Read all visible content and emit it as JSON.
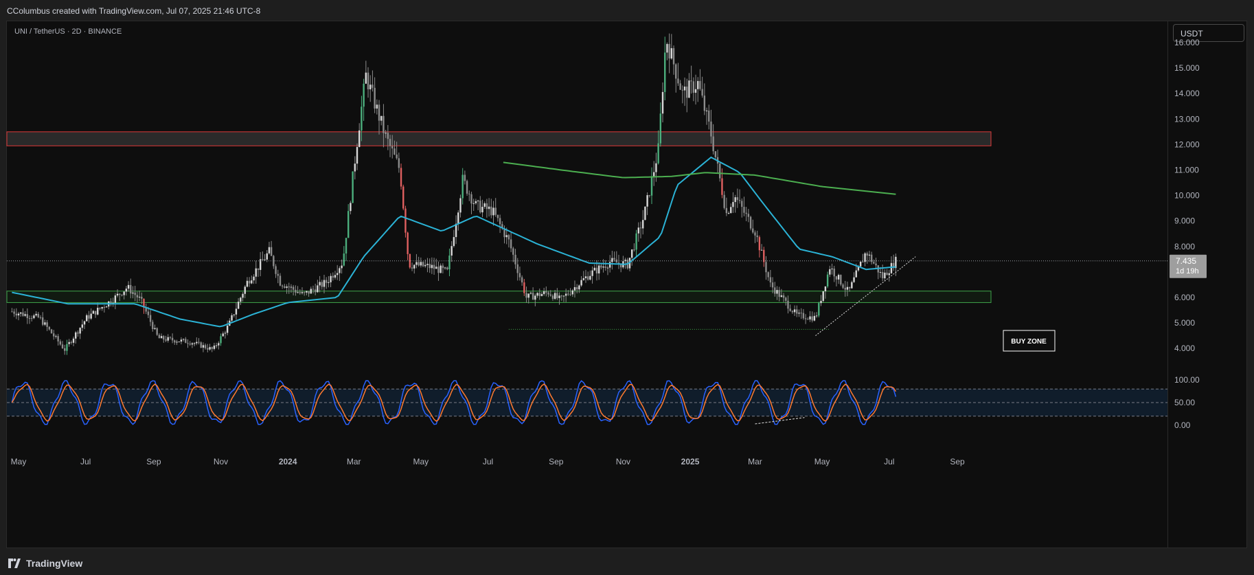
{
  "header": {
    "credit": "CColumbus created with TradingView.com, Jul 07, 2025 21:46 UTC-8"
  },
  "symbol_label": "UNI / TetherUS · 2D · BINANCE",
  "currency_button": "USDT",
  "footer": {
    "brand": "TradingView"
  },
  "chart_data": {
    "type": "candlestick",
    "symbol": "UNI / TetherUS",
    "interval": "2D",
    "exchange": "BINANCE",
    "price_axis": {
      "ticks": [
        "16.000",
        "15.000",
        "14.000",
        "13.000",
        "12.000",
        "11.000",
        "10.000",
        "9.000",
        "8.000",
        "6.000",
        "5.000",
        "4.000"
      ],
      "range": [
        3.4,
        16.8
      ]
    },
    "time_axis": {
      "ticks": [
        {
          "label": "May",
          "bold": false
        },
        {
          "label": "Jul",
          "bold": false
        },
        {
          "label": "Sep",
          "bold": false
        },
        {
          "label": "Nov",
          "bold": false
        },
        {
          "label": "2024",
          "bold": true
        },
        {
          "label": "Mar",
          "bold": false
        },
        {
          "label": "May",
          "bold": false
        },
        {
          "label": "Jul",
          "bold": false
        },
        {
          "label": "Sep",
          "bold": false
        },
        {
          "label": "Nov",
          "bold": false
        },
        {
          "label": "2025",
          "bold": true
        },
        {
          "label": "Mar",
          "bold": false
        },
        {
          "label": "May",
          "bold": false
        },
        {
          "label": "Jul",
          "bold": false
        },
        {
          "label": "Sep",
          "bold": false
        }
      ]
    },
    "last_price": {
      "value": "7.435",
      "countdown": "1d 19h"
    },
    "anchors": [
      [
        "2023-04-25",
        5.45
      ],
      [
        "2023-05-20",
        5.2
      ],
      [
        "2023-06-12",
        3.95
      ],
      [
        "2023-07-02",
        5.2
      ],
      [
        "2023-07-25",
        5.9
      ],
      [
        "2023-08-08",
        6.4
      ],
      [
        "2023-08-20",
        5.9
      ],
      [
        "2023-09-05",
        4.4
      ],
      [
        "2023-10-05",
        4.25
      ],
      [
        "2023-10-25",
        3.95
      ],
      [
        "2023-11-08",
        4.9
      ],
      [
        "2023-11-25",
        6.6
      ],
      [
        "2023-12-15",
        7.8
      ],
      [
        "2023-12-25",
        6.6
      ],
      [
        "2024-01-15",
        6.1
      ],
      [
        "2024-02-05",
        6.6
      ],
      [
        "2024-02-20",
        7.4
      ],
      [
        "2024-03-05",
        12.5
      ],
      [
        "2024-03-12",
        14.7
      ],
      [
        "2024-03-30",
        12.3
      ],
      [
        "2024-04-12",
        11.0
      ],
      [
        "2024-04-20",
        7.3
      ],
      [
        "2024-05-10",
        7.2
      ],
      [
        "2024-05-25",
        7.0
      ],
      [
        "2024-06-08",
        10.6
      ],
      [
        "2024-06-20",
        9.6
      ],
      [
        "2024-07-05",
        9.4
      ],
      [
        "2024-07-20",
        8.2
      ],
      [
        "2024-08-05",
        6.0
      ],
      [
        "2024-08-25",
        6.2
      ],
      [
        "2024-09-05",
        5.9
      ],
      [
        "2024-10-01",
        6.9
      ],
      [
        "2024-10-20",
        7.4
      ],
      [
        "2024-11-05",
        7.3
      ],
      [
        "2024-11-20",
        9.2
      ],
      [
        "2024-12-03",
        11.8
      ],
      [
        "2024-12-10",
        16.2
      ],
      [
        "2024-12-25",
        14.0
      ],
      [
        "2025-01-08",
        14.4
      ],
      [
        "2025-01-20",
        12.4
      ],
      [
        "2025-02-03",
        9.3
      ],
      [
        "2025-02-10",
        10.0
      ],
      [
        "2025-03-01",
        8.6
      ],
      [
        "2025-03-15",
        6.5
      ],
      [
        "2025-04-08",
        5.3
      ],
      [
        "2025-04-25",
        5.2
      ],
      [
        "2025-05-08",
        7.2
      ],
      [
        "2025-05-25",
        6.2
      ],
      [
        "2025-06-10",
        7.8
      ],
      [
        "2025-06-25",
        6.8
      ],
      [
        "2025-07-07",
        7.435
      ]
    ],
    "ema_short": [
      [
        "2023-04-25",
        6.2
      ],
      [
        "2023-06-15",
        5.75
      ],
      [
        "2023-08-15",
        5.75
      ],
      [
        "2023-09-25",
        5.15
      ],
      [
        "2023-11-01",
        4.85
      ],
      [
        "2023-12-01",
        5.35
      ],
      [
        "2024-01-01",
        5.8
      ],
      [
        "2024-02-15",
        6.0
      ],
      [
        "2024-03-10",
        7.6
      ],
      [
        "2024-04-12",
        9.2
      ],
      [
        "2024-05-20",
        8.6
      ],
      [
        "2024-06-20",
        9.2
      ],
      [
        "2024-08-15",
        8.1
      ],
      [
        "2024-10-01",
        7.35
      ],
      [
        "2024-11-05",
        7.3
      ],
      [
        "2024-12-05",
        8.4
      ],
      [
        "2024-12-20",
        10.4
      ],
      [
        "2025-01-20",
        11.5
      ],
      [
        "2025-02-15",
        10.9
      ],
      [
        "2025-03-10",
        9.6
      ],
      [
        "2025-04-10",
        7.9
      ],
      [
        "2025-05-10",
        7.6
      ],
      [
        "2025-06-10",
        7.1
      ],
      [
        "2025-07-07",
        7.2
      ]
    ],
    "ema_long": [
      [
        "2024-07-15",
        11.3
      ],
      [
        "2024-09-15",
        10.95
      ],
      [
        "2024-11-01",
        10.7
      ],
      [
        "2024-12-15",
        10.75
      ],
      [
        "2025-01-15",
        10.9
      ],
      [
        "2025-03-01",
        10.8
      ],
      [
        "2025-05-01",
        10.35
      ],
      [
        "2025-07-07",
        10.05
      ]
    ],
    "zones": [
      {
        "name": "resistance",
        "top": 12.5,
        "bottom": 11.95,
        "border": "#e03a3a",
        "fill": "#2a2a2a"
      },
      {
        "name": "support",
        "top": 6.25,
        "bottom": 5.8,
        "border": "#3fa64a",
        "fill": "#111a11"
      }
    ],
    "annotations": [
      {
        "type": "label",
        "text": "BUY ZONE"
      },
      {
        "type": "trendline",
        "from": [
          "2025-04-25",
          4.5
        ],
        "to": [
          "2025-07-25",
          7.6
        ],
        "style": "dotted"
      }
    ],
    "oscillator": {
      "type": "stochastic_rsi",
      "ticks": [
        "100.00",
        "50.00",
        "0.00"
      ],
      "upper_band": 80,
      "lower_band": 20
    },
    "colors": {
      "up": "#4caf7d",
      "down": "#e06060",
      "neutral": "#8c8c8c",
      "ema_short": "#2bb3d6",
      "ema_long": "#4caf50",
      "k_line": "#2962ff",
      "d_line": "#ff7a30"
    }
  }
}
